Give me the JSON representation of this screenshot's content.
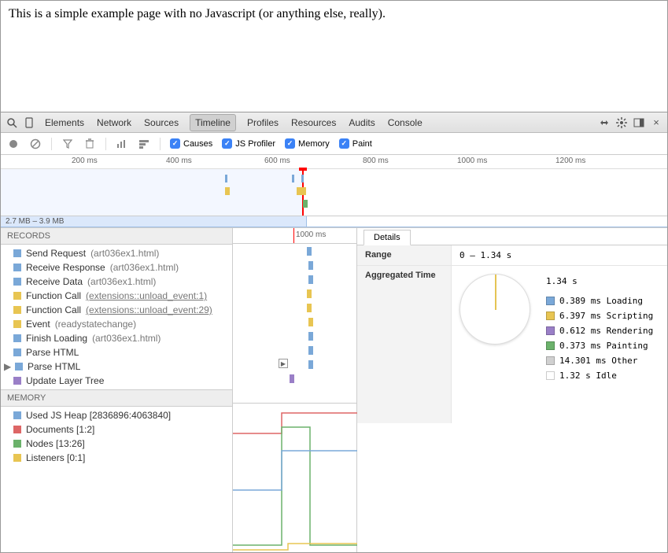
{
  "page": {
    "text": "This is a simple example page with no Javascript (or anything else, really)."
  },
  "toolbar": {
    "tabs": [
      "Elements",
      "Network",
      "Sources",
      "Timeline",
      "Profiles",
      "Resources",
      "Audits",
      "Console"
    ],
    "active_tab": "Timeline"
  },
  "subtoolbar": {
    "causes": "Causes",
    "js_profiler": "JS Profiler",
    "memory": "Memory",
    "paint": "Paint"
  },
  "ruler": {
    "ticks": [
      "200 ms",
      "400 ms",
      "600 ms",
      "800 ms",
      "1000 ms",
      "1200 ms"
    ]
  },
  "mem_strip": "2.7 MB – 3.9 MB",
  "records": {
    "header": "RECORDS",
    "items": [
      {
        "color": "c-blue",
        "name": "Send Request",
        "detail": "(art036ex1.html)",
        "underline": false
      },
      {
        "color": "c-blue",
        "name": "Receive Response",
        "detail": "(art036ex1.html)",
        "underline": false
      },
      {
        "color": "c-blue",
        "name": "Receive Data",
        "detail": "(art036ex1.html)",
        "underline": false
      },
      {
        "color": "c-yellow",
        "name": "Function Call",
        "detail": "(extensions::unload_event:1)",
        "underline": true
      },
      {
        "color": "c-yellow",
        "name": "Function Call",
        "detail": "(extensions::unload_event:29)",
        "underline": true
      },
      {
        "color": "c-yellow",
        "name": "Event",
        "detail": "(readystatechange)",
        "underline": false
      },
      {
        "color": "c-blue",
        "name": "Finish Loading",
        "detail": "(art036ex1.html)",
        "underline": false
      },
      {
        "color": "c-blue",
        "name": "Parse HTML",
        "detail": "",
        "underline": false
      },
      {
        "color": "c-blue",
        "name": "Parse HTML",
        "detail": "",
        "underline": false,
        "expandable": true
      },
      {
        "color": "c-purple",
        "name": "Update Layer Tree",
        "detail": "",
        "underline": false
      }
    ]
  },
  "memory": {
    "header": "MEMORY",
    "items": [
      {
        "color": "c-blue",
        "name": "Used JS Heap [2836896:4063840]"
      },
      {
        "color": "c-red",
        "name": "Documents [1:2]"
      },
      {
        "color": "c-green",
        "name": "Nodes [13:26]"
      },
      {
        "color": "c-yellow",
        "name": "Listeners [0:1]"
      }
    ]
  },
  "bars": {
    "header_tick": "1000 ms"
  },
  "details": {
    "tab": "Details",
    "range_label": "Range",
    "range_value": "0 – 1.34 s",
    "agg_label": "Aggregated Time",
    "total": "1.34 s",
    "legend": [
      {
        "color": "c-blue",
        "text": "0.389 ms Loading"
      },
      {
        "color": "c-yellow",
        "text": "6.397 ms Scripting"
      },
      {
        "color": "c-purple",
        "text": "0.612 ms Rendering"
      },
      {
        "color": "c-green",
        "text": "0.373 ms Painting"
      },
      {
        "color": "c-gray",
        "text": "14.301 ms Other"
      },
      {
        "color": "c-white",
        "text": "1.32 s Idle"
      }
    ]
  },
  "chart_data": {
    "type": "pie",
    "title": "Aggregated Time",
    "total_seconds": 1.34,
    "series": [
      {
        "name": "Loading",
        "value_ms": 0.389
      },
      {
        "name": "Scripting",
        "value_ms": 6.397
      },
      {
        "name": "Rendering",
        "value_ms": 0.612
      },
      {
        "name": "Painting",
        "value_ms": 0.373
      },
      {
        "name": "Other",
        "value_ms": 14.301
      },
      {
        "name": "Idle",
        "value_ms": 1320
      }
    ]
  }
}
